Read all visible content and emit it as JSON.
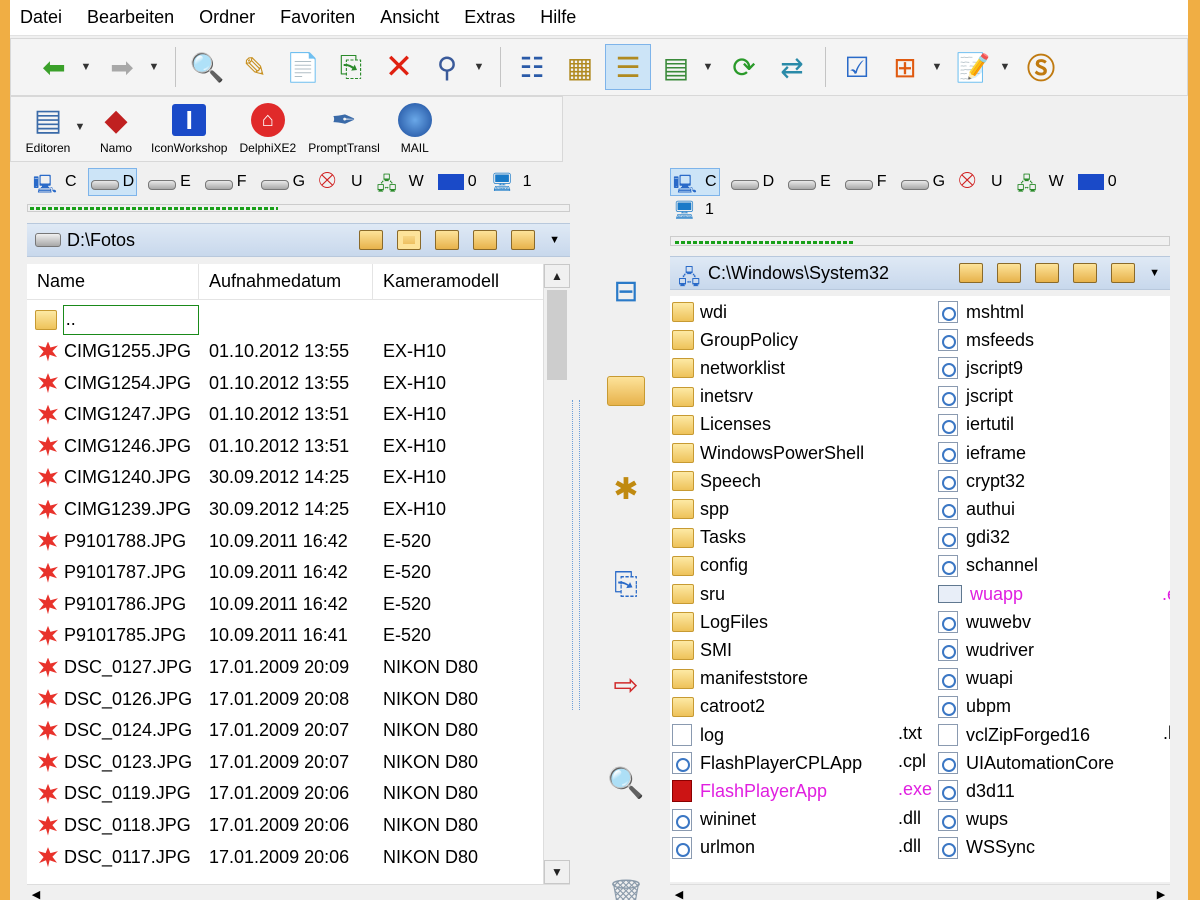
{
  "menu": [
    "Datei",
    "Bearbeiten",
    "Ordner",
    "Favoriten",
    "Ansicht",
    "Extras",
    "Hilfe"
  ],
  "toolbar2": [
    {
      "label": "Editoren",
      "icon": "editors-icon"
    },
    {
      "label": "Namo",
      "icon": "namo-icon"
    },
    {
      "label": "IconWorkshop",
      "icon": "iconworkshop-icon"
    },
    {
      "label": "DelphiXE2",
      "icon": "delphi-icon"
    },
    {
      "label": "PromptTransl",
      "icon": "quill-icon"
    },
    {
      "label": "MAIL",
      "icon": "thunderbird-icon"
    }
  ],
  "drives_left": [
    "C",
    "D",
    "E",
    "F",
    "G",
    "U",
    "W",
    "0",
    "1"
  ],
  "drives_right": [
    "C",
    "D",
    "E",
    "F",
    "G",
    "U",
    "W",
    "0",
    "1"
  ],
  "left": {
    "path": "D:\\Fotos",
    "columns": [
      "Name",
      "Aufnahmedatum",
      "Kameramodell"
    ],
    "parent": "..",
    "files": [
      {
        "name": "CIMG1255.JPG",
        "date": "01.10.2012 13:55",
        "camera": "EX-H10"
      },
      {
        "name": "CIMG1254.JPG",
        "date": "01.10.2012 13:55",
        "camera": "EX-H10"
      },
      {
        "name": "CIMG1247.JPG",
        "date": "01.10.2012 13:51",
        "camera": "EX-H10"
      },
      {
        "name": "CIMG1246.JPG",
        "date": "01.10.2012 13:51",
        "camera": "EX-H10"
      },
      {
        "name": "CIMG1240.JPG",
        "date": "30.09.2012 14:25",
        "camera": "EX-H10"
      },
      {
        "name": "CIMG1239.JPG",
        "date": "30.09.2012 14:25",
        "camera": "EX-H10"
      },
      {
        "name": "P9101788.JPG",
        "date": "10.09.2011 16:42",
        "camera": "E-520"
      },
      {
        "name": "P9101787.JPG",
        "date": "10.09.2011 16:42",
        "camera": "E-520"
      },
      {
        "name": "P9101786.JPG",
        "date": "10.09.2011 16:42",
        "camera": "E-520"
      },
      {
        "name": "P9101785.JPG",
        "date": "10.09.2011 16:41",
        "camera": "E-520"
      },
      {
        "name": "DSC_0127.JPG",
        "date": "17.01.2009 20:09",
        "camera": "NIKON D80"
      },
      {
        "name": "DSC_0126.JPG",
        "date": "17.01.2009 20:08",
        "camera": "NIKON D80"
      },
      {
        "name": "DSC_0124.JPG",
        "date": "17.01.2009 20:07",
        "camera": "NIKON D80"
      },
      {
        "name": "DSC_0123.JPG",
        "date": "17.01.2009 20:07",
        "camera": "NIKON D80"
      },
      {
        "name": "DSC_0119.JPG",
        "date": "17.01.2009 20:06",
        "camera": "NIKON D80"
      },
      {
        "name": "DSC_0118.JPG",
        "date": "17.01.2009 20:06",
        "camera": "NIKON D80"
      },
      {
        "name": "DSC_0117.JPG",
        "date": "17.01.2009 20:06",
        "camera": "NIKON D80"
      }
    ]
  },
  "right": {
    "path": "C:\\Windows\\System32",
    "col1": [
      {
        "name": "wdi",
        "type": "folder"
      },
      {
        "name": "GroupPolicy",
        "type": "folder"
      },
      {
        "name": "networklist",
        "type": "folder"
      },
      {
        "name": "inetsrv",
        "type": "folder"
      },
      {
        "name": "Licenses",
        "type": "folder"
      },
      {
        "name": "WindowsPowerShell",
        "type": "folder"
      },
      {
        "name": "Speech",
        "type": "folder"
      },
      {
        "name": "spp",
        "type": "folder"
      },
      {
        "name": "Tasks",
        "type": "folder"
      },
      {
        "name": "config",
        "type": "folder"
      },
      {
        "name": "sru",
        "type": "folder"
      },
      {
        "name": "LogFiles",
        "type": "folder"
      },
      {
        "name": "SMI",
        "type": "folder"
      },
      {
        "name": "manifeststore",
        "type": "folder"
      },
      {
        "name": "catroot2",
        "type": "folder"
      },
      {
        "name": "log",
        "type": "file",
        "ext": ".txt"
      },
      {
        "name": "FlashPlayerCPLApp",
        "type": "dll",
        "ext": ".cpl"
      },
      {
        "name": "FlashPlayerApp",
        "type": "exe",
        "ext": ".exe"
      },
      {
        "name": "wininet",
        "type": "dll",
        "ext": ".dll"
      },
      {
        "name": "urlmon",
        "type": "dll",
        "ext": ".dll"
      }
    ],
    "col2": [
      {
        "name": "mshtml",
        "type": "dll"
      },
      {
        "name": "msfeeds",
        "type": "dll"
      },
      {
        "name": "jscript9",
        "type": "dll"
      },
      {
        "name": "jscript",
        "type": "dll"
      },
      {
        "name": "iertutil",
        "type": "dll"
      },
      {
        "name": "ieframe",
        "type": "dll"
      },
      {
        "name": "crypt32",
        "type": "dll"
      },
      {
        "name": "authui",
        "type": "dll"
      },
      {
        "name": "gdi32",
        "type": "dll"
      },
      {
        "name": "schannel",
        "type": "dll"
      },
      {
        "name": "wuapp",
        "type": "wu",
        "magenta": true
      },
      {
        "name": "wuwebv",
        "type": "dll"
      },
      {
        "name": "wudriver",
        "type": "dll"
      },
      {
        "name": "wuapi",
        "type": "dll"
      },
      {
        "name": "ubpm",
        "type": "dll"
      },
      {
        "name": "vclZipForged16",
        "type": "file"
      },
      {
        "name": "UIAutomationCore",
        "type": "dll"
      },
      {
        "name": "d3d11",
        "type": "dll"
      },
      {
        "name": "wups",
        "type": "dll"
      },
      {
        "name": "WSSync",
        "type": "dll"
      }
    ],
    "cut_ext_top": ".e",
    "cut_ext_bottom": ".l"
  }
}
